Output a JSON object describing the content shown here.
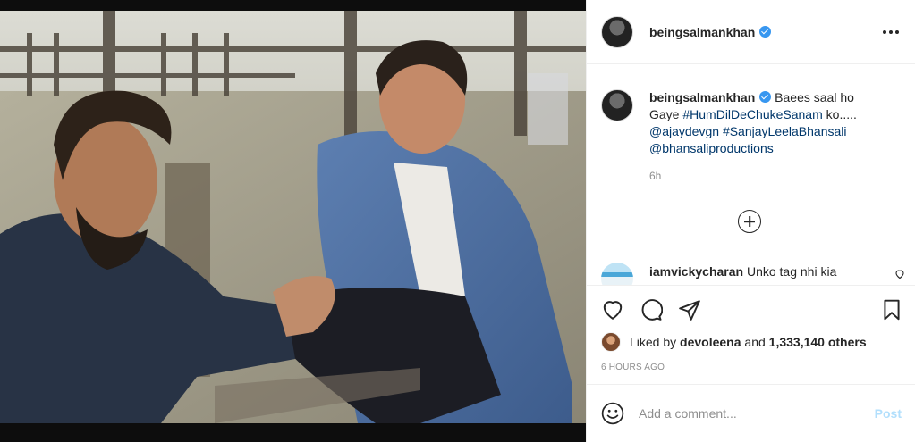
{
  "post": {
    "username": "beingsalmankhan",
    "verified": true,
    "menu_icon": "more-horizontal-icon",
    "caption": {
      "username": "beingsalmankhan",
      "text_1": "Baees saal ho Gaye ",
      "hashtag_1": "#HumDilDeChukeSanam",
      "text_2": " ko..... ",
      "mention_1": "@ajaydevgn",
      "hashtag_2": "#SanjayLeelaBhansali",
      "mention_2": "@bhansaliproductions",
      "time": "6h"
    },
    "comments": [
      {
        "username": "iamvickycharan",
        "text": "Unko tag nhi kia"
      }
    ],
    "actions": {
      "like": "heart-icon",
      "comment": "comment-icon",
      "share": "share-icon",
      "save": "bookmark-icon"
    },
    "likes": {
      "prefix": "Liked by ",
      "user": "devoleena",
      "middle": " and ",
      "count": "1,333,140 others"
    },
    "timestamp": "6 HOURS AGO",
    "add_comment": {
      "placeholder": "Add a comment...",
      "post_label": "Post"
    }
  },
  "colors": {
    "link": "#00376b",
    "verified": "#3897f0",
    "post_disabled": "#b2dffc",
    "muted": "#8e8e8e"
  }
}
